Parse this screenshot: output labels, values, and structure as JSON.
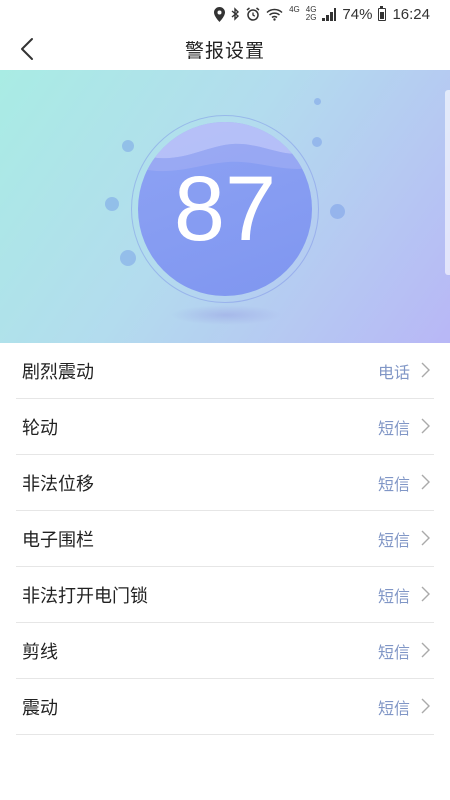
{
  "status_bar": {
    "battery": "74%",
    "time": "16:24",
    "net_top": "4G",
    "net_bottom": "2G",
    "net_top2": "4G",
    "icons": [
      "location-icon",
      "bluetooth-icon",
      "alarm-icon",
      "wifi-icon",
      "signal-icon",
      "battery-icon"
    ]
  },
  "header": {
    "title": "警报设置",
    "back_icon": "chevron-left-icon"
  },
  "hero": {
    "score": "87",
    "colors": {
      "gradient_start": "#a9ece4",
      "gradient_end": "#b8b7f6",
      "circle": "#8a9ff3"
    }
  },
  "alarms": [
    {
      "label": "剧烈震动",
      "value": "电话"
    },
    {
      "label": "轮动",
      "value": "短信"
    },
    {
      "label": "非法位移",
      "value": "短信"
    },
    {
      "label": "电子围栏",
      "value": "短信"
    },
    {
      "label": "非法打开电门锁",
      "value": "短信"
    },
    {
      "label": "剪线",
      "value": "短信"
    },
    {
      "label": "震动",
      "value": "短信"
    }
  ],
  "colors": {
    "accent_text": "#8096c6",
    "divider": "#e6e6e6"
  }
}
